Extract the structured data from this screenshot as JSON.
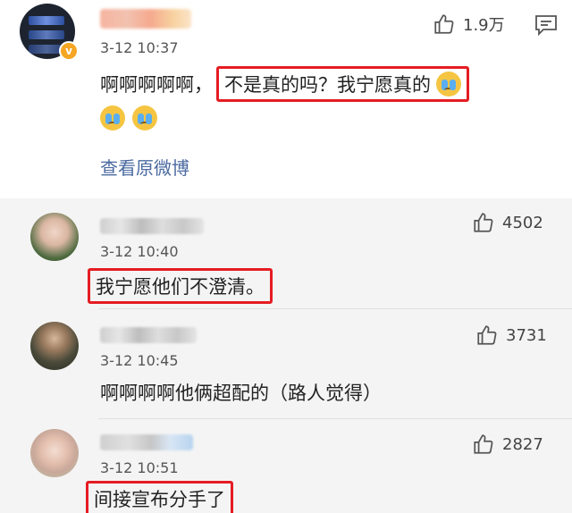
{
  "main": {
    "time": "3-12 10:37",
    "likes": "1.9万",
    "text_prefix": "啊啊啊啊啊，",
    "text_highlight": "不是真的吗？我宁愿真的",
    "view_original": "查看原微博"
  },
  "replies": [
    {
      "time": "3-12 10:40",
      "likes": "4502",
      "text": "我宁愿他们不澄清。"
    },
    {
      "time": "3-12 10:45",
      "likes": "3731",
      "text": "啊啊啊啊他俩超配的（路人觉得）"
    },
    {
      "time": "3-12 10:51",
      "likes": "2827",
      "text": "间接宣布分手了"
    }
  ],
  "colors": {
    "highlight_border": "#e51c23",
    "link": "#4a6aa0",
    "verified": "#f5a623"
  },
  "icons": [
    "thumbs-up-icon",
    "comment-icon",
    "verified-badge-icon",
    "crying-emoji-icon"
  ]
}
